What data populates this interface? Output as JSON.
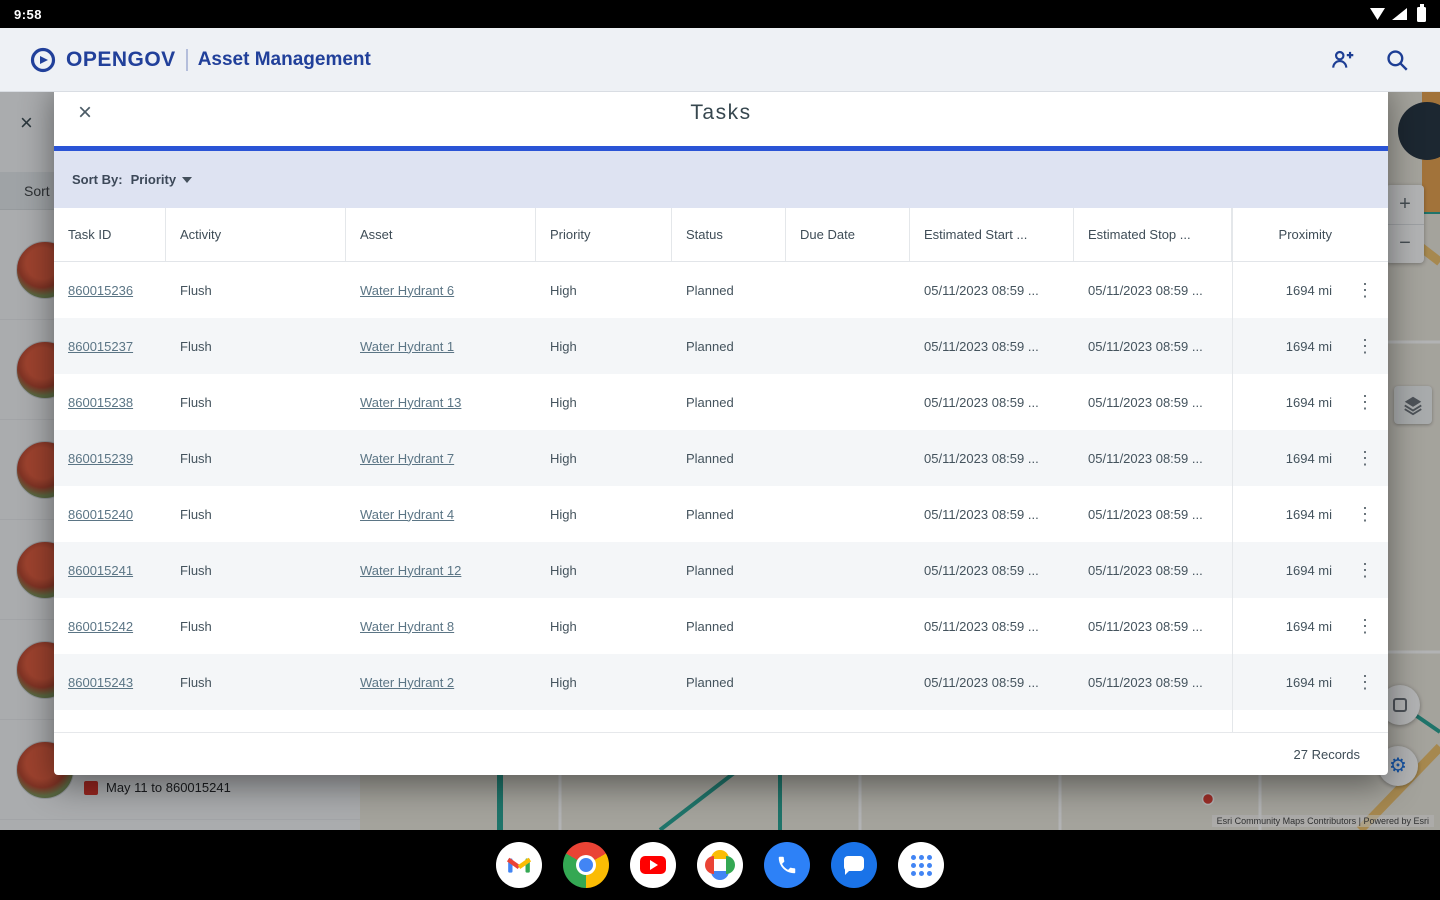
{
  "status_bar": {
    "time": "9:58"
  },
  "app_bar": {
    "brand": "OPENGOV",
    "title": "Asset Management"
  },
  "left_panel": {
    "sort_label": "Sort",
    "schedule_item": "May 11 to 860015241"
  },
  "modal": {
    "title": "Tasks",
    "sort_by_label": "Sort By:",
    "sort_by_value": "Priority",
    "records_summary": "27 Records",
    "columns": [
      "Task ID",
      "Activity",
      "Asset",
      "Priority",
      "Status",
      "Due Date",
      "Estimated Start ...",
      "Estimated Stop ...",
      "Proximity"
    ],
    "rows": [
      {
        "id": "860015236",
        "activity": "Flush",
        "asset": "Water Hydrant 6",
        "priority": "High",
        "status": "Planned",
        "due": "",
        "start": "05/11/2023 08:59 ...",
        "stop": "05/11/2023 08:59 ...",
        "proximity": "1694 mi"
      },
      {
        "id": "860015237",
        "activity": "Flush",
        "asset": "Water Hydrant 1",
        "priority": "High",
        "status": "Planned",
        "due": "",
        "start": "05/11/2023 08:59 ...",
        "stop": "05/11/2023 08:59 ...",
        "proximity": "1694 mi"
      },
      {
        "id": "860015238",
        "activity": "Flush",
        "asset": "Water Hydrant 13",
        "priority": "High",
        "status": "Planned",
        "due": "",
        "start": "05/11/2023 08:59 ...",
        "stop": "05/11/2023 08:59 ...",
        "proximity": "1694 mi"
      },
      {
        "id": "860015239",
        "activity": "Flush",
        "asset": "Water Hydrant 7",
        "priority": "High",
        "status": "Planned",
        "due": "",
        "start": "05/11/2023 08:59 ...",
        "stop": "05/11/2023 08:59 ...",
        "proximity": "1694 mi"
      },
      {
        "id": "860015240",
        "activity": "Flush",
        "asset": "Water Hydrant 4",
        "priority": "High",
        "status": "Planned",
        "due": "",
        "start": "05/11/2023 08:59 ...",
        "stop": "05/11/2023 08:59 ...",
        "proximity": "1694 mi"
      },
      {
        "id": "860015241",
        "activity": "Flush",
        "asset": "Water Hydrant 12",
        "priority": "High",
        "status": "Planned",
        "due": "",
        "start": "05/11/2023 08:59 ...",
        "stop": "05/11/2023 08:59 ...",
        "proximity": "1694 mi"
      },
      {
        "id": "860015242",
        "activity": "Flush",
        "asset": "Water Hydrant 8",
        "priority": "High",
        "status": "Planned",
        "due": "",
        "start": "05/11/2023 08:59 ...",
        "stop": "05/11/2023 08:59 ...",
        "proximity": "1694 mi"
      },
      {
        "id": "860015243",
        "activity": "Flush",
        "asset": "Water Hydrant 2",
        "priority": "High",
        "status": "Planned",
        "due": "",
        "start": "05/11/2023 08:59 ...",
        "stop": "05/11/2023 08:59 ...",
        "proximity": "1694 mi"
      }
    ]
  },
  "map": {
    "attribution": "Esri Community Maps Contributors | Powered by Esri",
    "zoom_in": "+",
    "zoom_out": "−"
  },
  "dock": {
    "apps": [
      "Gmail",
      "Chrome",
      "YouTube",
      "Photos",
      "Phone",
      "Messages",
      "All Apps"
    ]
  },
  "colors": {
    "accent": "#2a54d6",
    "brand_navy": "#21409a",
    "link": "#5b7585",
    "map_teal": "#27a293"
  }
}
